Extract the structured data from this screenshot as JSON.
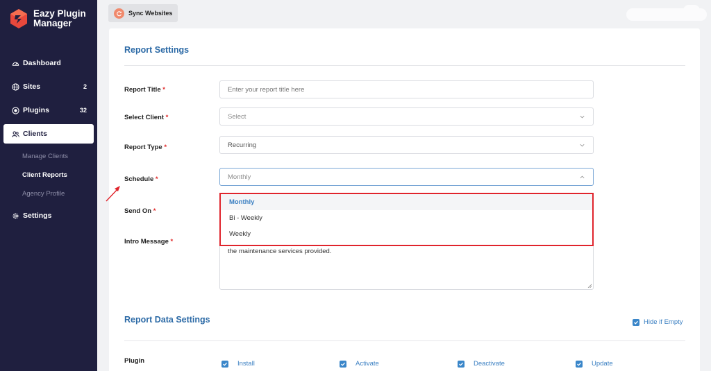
{
  "brand": {
    "line1": "Eazy Plugin",
    "line2": "Manager"
  },
  "sidebar": {
    "items": [
      {
        "label": "Dashboard",
        "icon": "dashboard-gauge-icon",
        "count": ""
      },
      {
        "label": "Sites",
        "icon": "globe-icon",
        "count": "2"
      },
      {
        "label": "Plugins",
        "icon": "plugin-icon",
        "count": "32"
      },
      {
        "label": "Clients",
        "icon": "users-icon",
        "count": ""
      },
      {
        "label": "Settings",
        "icon": "gear-icon",
        "count": ""
      }
    ],
    "sub_items": [
      {
        "label": "Manage Clients"
      },
      {
        "label": "Client Reports"
      },
      {
        "label": "Agency Profile"
      }
    ]
  },
  "topbar": {
    "sync_label": "Sync Websites",
    "sync_icon": "refresh-icon"
  },
  "form": {
    "section_title": "Report Settings",
    "report_title": {
      "label": "Report Title",
      "placeholder": "Enter your report title here"
    },
    "select_client": {
      "label": "Select Client",
      "value": "Select"
    },
    "report_type": {
      "label": "Report Type",
      "value": "Recurring"
    },
    "schedule": {
      "label": "Schedule",
      "value": "Monthly",
      "options": [
        "Monthly",
        "Bi - Weekly",
        "Weekly"
      ]
    },
    "send_on": {
      "label": "Send On"
    },
    "intro_message": {
      "label": "Intro Message",
      "value": "the maintenance services provided."
    },
    "required_mark": "*"
  },
  "data_settings": {
    "section_title": "Report Data Settings",
    "hide_if_empty": "Hide if Empty",
    "plugin_label": "Plugin",
    "plugin_options": [
      "Install",
      "Activate",
      "Deactivate",
      "Update"
    ]
  },
  "colors": {
    "sidebar_bg": "#1f1f3f",
    "accent_blue": "#2c6aa6",
    "highlight_red": "#e0242c",
    "sync_icon": "#f0896c"
  }
}
